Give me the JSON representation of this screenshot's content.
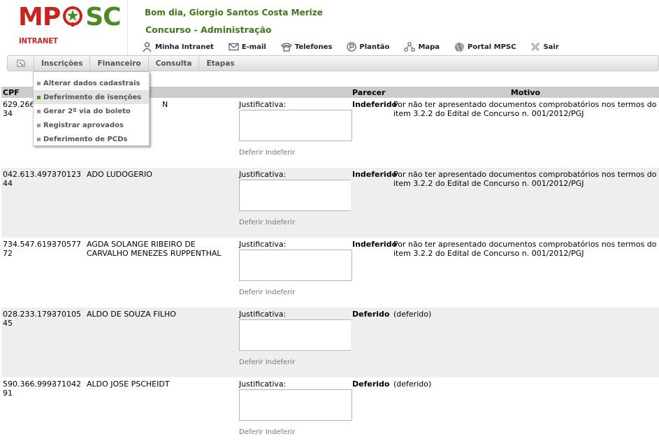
{
  "header": {
    "logo_left": "MP",
    "logo_right": "SC",
    "logo_sub": "INTRANET",
    "greeting": "Bom dia, Giorgio Santos Costa Merize",
    "page_title": "Concurso - Administração",
    "nav": [
      {
        "label": "Minha Intranet",
        "icon": "person-icon"
      },
      {
        "label": "E-mail",
        "icon": "envelope-icon"
      },
      {
        "label": "Telefones",
        "icon": "phone-icon"
      },
      {
        "label": "Plantão",
        "icon": "p-circle-icon"
      },
      {
        "label": "Mapa",
        "icon": "map-icon"
      },
      {
        "label": "Portal MPSC",
        "icon": "globe-icon"
      },
      {
        "label": "Sair",
        "icon": "exit-icon"
      }
    ]
  },
  "menubar": {
    "items": [
      "Inscrições",
      "Financeiro",
      "Consulta",
      "Etapas"
    ]
  },
  "dropdown": {
    "items": [
      {
        "label": "Alterar dados cadastrais",
        "active": false
      },
      {
        "label": "Deferimento de isenções",
        "active": true
      },
      {
        "label": "Gerar 2º via do boleto",
        "active": false
      },
      {
        "label": "Registrar aprovados",
        "active": false
      },
      {
        "label": "Deferimento de PCDs",
        "active": false
      }
    ]
  },
  "table": {
    "headers": {
      "cpf": "CPF",
      "parecer": "Parecer",
      "motivo": "Motivo"
    },
    "justif_label": "Justificativa:",
    "deferir": "Deferir",
    "indeferir": "Indeferir",
    "rows": [
      {
        "cpf_a": "629.266.",
        "cpf_b": "34",
        "inscricao": "",
        "nome": "N",
        "parecer": "Indeferido",
        "motivo": "Por não ter apresentado documentos comprobatórios nos termos do item 3.2.2 do Edital de Concurso n. 001/2012/PGJ"
      },
      {
        "cpf_a": "042.613.497-",
        "cpf_b": "44",
        "inscricao": "370123",
        "nome": "ADO LUDOGERIO",
        "parecer": "Indeferido",
        "motivo": "Por não ter apresentado documentos comprobatórios nos termos do item 3.2.2 do Edital de Concurso n. 001/2012/PGJ"
      },
      {
        "cpf_a": "734.547.619-",
        "cpf_b": "72",
        "inscricao": "370577",
        "nome": "AGDA SOLANGE RIBEIRO DE CARVALHO MENEZES RUPPENTHAL",
        "parecer": "Indeferido",
        "motivo": "Por não ter apresentado documentos comprobatórios nos termos do item 3.2.2 do Edital de Concurso n. 001/2012/PGJ"
      },
      {
        "cpf_a": "028.233.179-",
        "cpf_b": "45",
        "inscricao": "370105",
        "nome": "ALDO DE SOUZA FILHO",
        "parecer": "Deferido",
        "motivo": "(deferido)"
      },
      {
        "cpf_a": "590.366.999-",
        "cpf_b": "91",
        "inscricao": "371042",
        "nome": "ALDO JOSE PSCHEIDT",
        "parecer": "Deferido",
        "motivo": "(deferido)"
      }
    ]
  },
  "colors": {
    "brand_red": "#c8231f",
    "brand_green": "#4c8a21",
    "title_green": "#3d7a17"
  }
}
